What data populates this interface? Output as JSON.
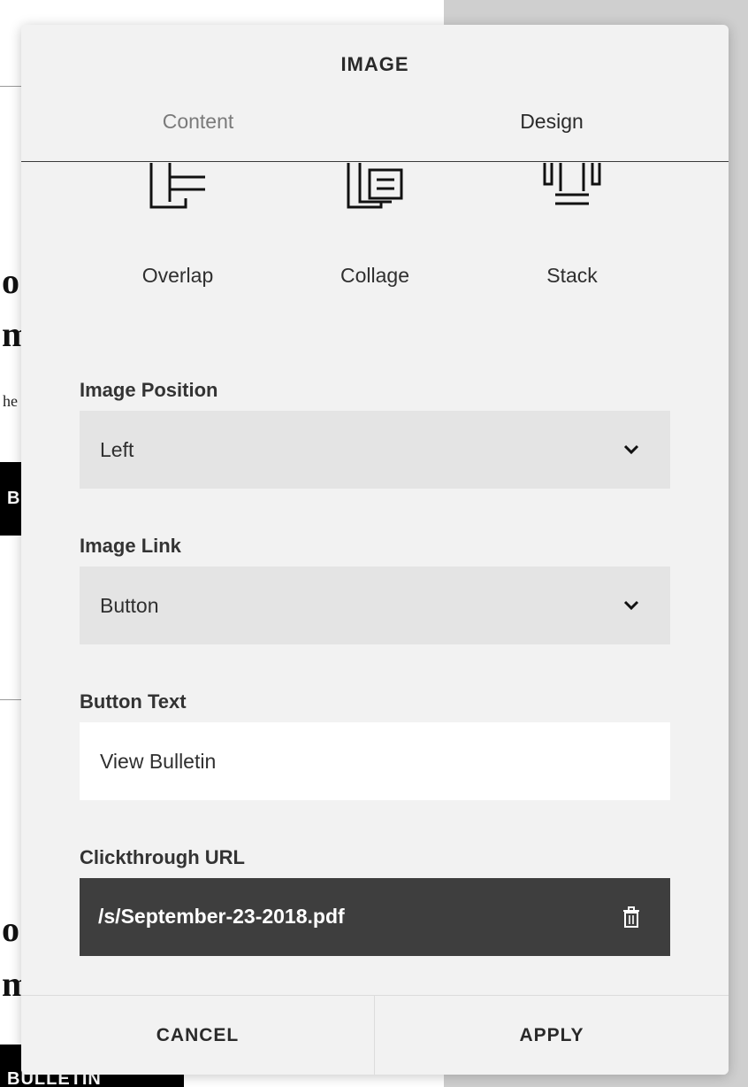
{
  "background": {
    "serif_top": [
      "o",
      "m"
    ],
    "small_text": "he",
    "button_1": "B",
    "serif_bottom": [
      "o",
      "m"
    ],
    "button_2": "BULLETIN"
  },
  "modal": {
    "title": "IMAGE",
    "tabs": [
      {
        "label": "Content",
        "active": false
      },
      {
        "label": "Design",
        "active": true
      }
    ],
    "layout_options": [
      {
        "label": "Overlap",
        "icon": "overlap-layout-icon"
      },
      {
        "label": "Collage",
        "icon": "collage-layout-icon"
      },
      {
        "label": "Stack",
        "icon": "stack-layout-icon"
      }
    ],
    "image_position": {
      "label": "Image Position",
      "value": "Left"
    },
    "image_link": {
      "label": "Image Link",
      "value": "Button"
    },
    "button_text": {
      "label": "Button Text",
      "value": "View Bulletin"
    },
    "clickthrough_url": {
      "label": "Clickthrough URL",
      "value": "/s/September-23-2018.pdf",
      "icon": "trash-icon"
    },
    "footer": {
      "cancel": "CANCEL",
      "apply": "APPLY"
    }
  },
  "colors": {
    "modal_bg": "#f2f2f2",
    "select_bg": "#e4e4e4",
    "url_bg": "#3e3e3e",
    "overlay": "#cfcfcf"
  }
}
